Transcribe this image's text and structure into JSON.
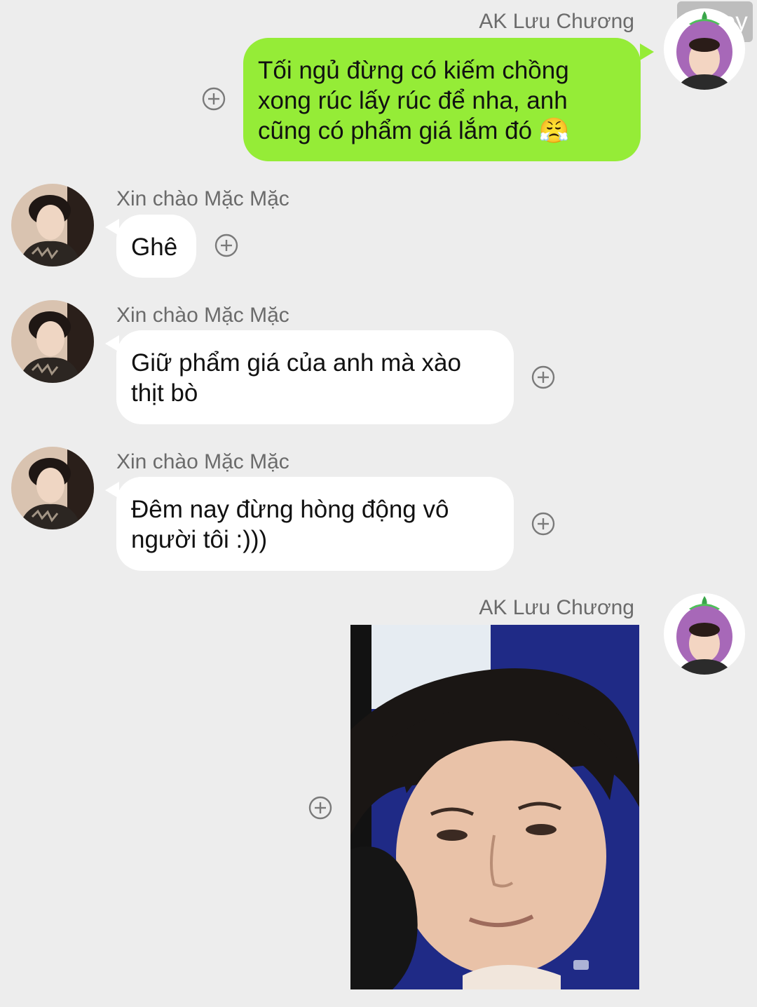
{
  "watermark": {
    "text": "86 joy"
  },
  "colors": {
    "background": "#ededed",
    "outgoing_bubble": "#95ec37",
    "incoming_bubble": "#ffffff",
    "sender_name": "#6b6b6b"
  },
  "messages": [
    {
      "direction": "outgoing",
      "sender": "AK Lưu Chương",
      "lines": [
        "Tối ngủ đừng có kiếm chồng",
        "xong rúc lấy rúc để nha, anh",
        "cũng có phẩm giá lắm đó"
      ],
      "emoji": "😤",
      "avatar": "eggplant-hat-avatar"
    },
    {
      "direction": "incoming",
      "sender": "Xin chào Mặc Mặc",
      "lines": [
        "Ghê"
      ],
      "avatar": "portrait-avatar"
    },
    {
      "direction": "incoming",
      "sender": "Xin chào Mặc Mặc",
      "lines": [
        "Giữ phẩm giá của anh mà xào",
        "thịt bò"
      ],
      "avatar": "portrait-avatar"
    },
    {
      "direction": "incoming",
      "sender": "Xin chào Mặc Mặc",
      "lines": [
        "Đêm nay đừng hòng động vô",
        "người tôi :)))"
      ],
      "avatar": "portrait-avatar"
    },
    {
      "direction": "outgoing",
      "sender": "AK Lưu Chương",
      "type": "image",
      "image": "face-photo",
      "avatar": "eggplant-hat-avatar"
    }
  ],
  "icons": {
    "add": "plus-circle-icon"
  }
}
